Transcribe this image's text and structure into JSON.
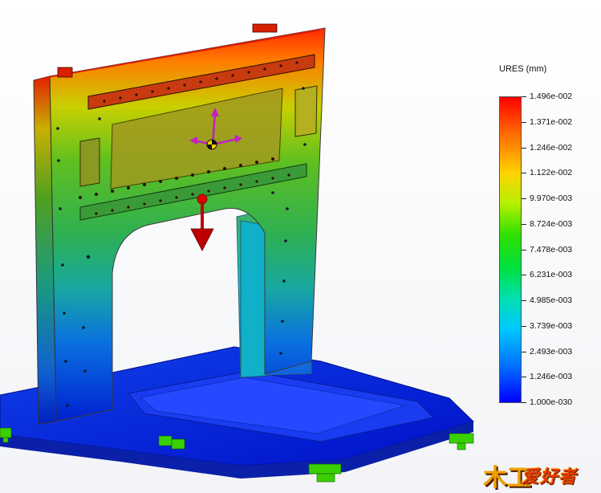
{
  "legend": {
    "title": "URES (mm)",
    "labels": [
      "1.496e-002",
      "1.371e-002",
      "1.246e-002",
      "1.122e-002",
      "9.970e-003",
      "8.724e-003",
      "7.478e-003",
      "6.231e-003",
      "4.985e-003",
      "3.739e-003",
      "2.493e-003",
      "1.246e-003",
      "1.000e-030"
    ],
    "max_color": "#ff0000",
    "min_color": "#0000ff"
  },
  "logo": {
    "mark": "木工",
    "text": "爱好者"
  },
  "icons": {
    "load_arrow": "red-force-arrow-icon",
    "csys": "coordinate-triad-icon",
    "fixtures": "green-fixture-icon"
  }
}
